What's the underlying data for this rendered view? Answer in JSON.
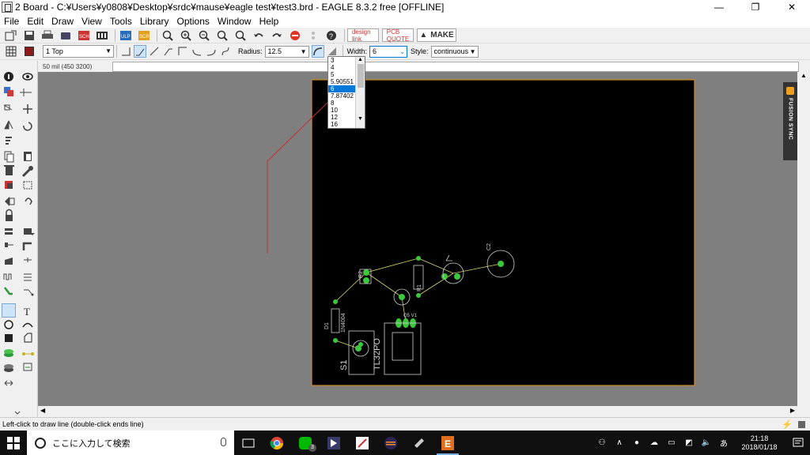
{
  "window": {
    "title": "2 Board - C:¥Users¥y0808¥Desktop¥srdc¥mause¥eagle test¥test3.brd - EAGLE 8.3.2 free [OFFLINE]",
    "minimize": "—",
    "maximize": "❐",
    "close": "✕"
  },
  "menu": [
    "File",
    "Edit",
    "Draw",
    "View",
    "Tools",
    "Library",
    "Options",
    "Window",
    "Help"
  ],
  "toolbar_ext": {
    "design_link": "design link",
    "pcb_quote": "PCB QUOTE",
    "make": "MAKE"
  },
  "params": {
    "layer": "1 Top",
    "layer_color": "#8b1a1a",
    "radius_label": "Radius:",
    "radius_value": "12.5",
    "width_label": "Width:",
    "width_value": "6",
    "style_label": "Style:",
    "style_value": "continuous"
  },
  "width_options": [
    "3",
    "4",
    "5",
    "5.90551",
    "6",
    "7.87402",
    "8",
    "10",
    "12",
    "16"
  ],
  "width_selected": "6",
  "coordinate": "50 mil (450 3200)",
  "board": {
    "labels": {
      "c2": "C2",
      "r1": "R1",
      "r2": "R2",
      "d1": "D1",
      "d1_part": "1N4004",
      "s1": "S1",
      "ic": "TL32PO",
      "q": "Q5 V1"
    }
  },
  "fusion_sync": "FUSION SYNC",
  "status": "Left-click to draw line (double-click ends line)",
  "taskbar": {
    "search_placeholder": "ここに入力して検索",
    "badge": "3",
    "time": "21:18",
    "date": "2018/01/18",
    "ime": "あ"
  },
  "colors": {
    "board_bg": "#000000",
    "board_outline": "#d08a20",
    "canvas_bg": "#7f7f7f",
    "pad_green": "#3cc83c",
    "airwire": "#d8d870",
    "silk": "#d0d0d0",
    "trace_red": "#c03030"
  }
}
